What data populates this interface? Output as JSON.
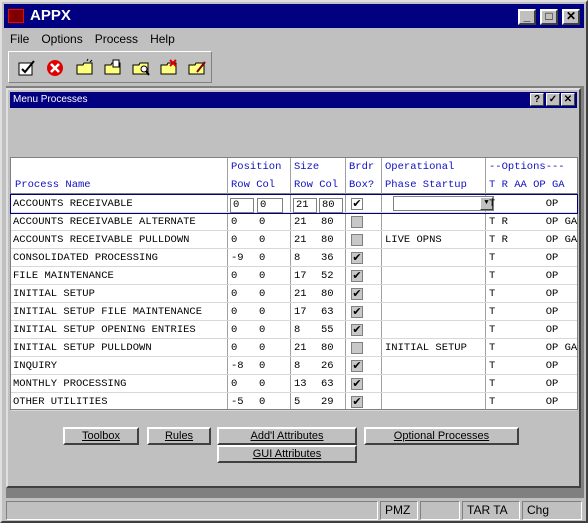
{
  "app": {
    "title": "APPX"
  },
  "menu": [
    "File",
    "Options",
    "Process",
    "Help"
  ],
  "toolbar": [
    "ok-check-icon",
    "cancel-icon",
    "folder-new-icon",
    "folder-open-icon",
    "folder-find-icon",
    "folder-delete-icon",
    "folder-edit-icon"
  ],
  "child": {
    "title": "Menu Processes",
    "buttons": [
      "?",
      "✓",
      "✕"
    ]
  },
  "grid": {
    "headers": {
      "process_name": "Process Name",
      "position": "Position",
      "pos_sub": "Row Col",
      "size": "Size",
      "size_sub": "Row Col",
      "brdr": "Brdr",
      "box": "Box?",
      "operational": "Operational",
      "phase": "Phase Startup",
      "options": "--Options---",
      "options_sub": "T R AA OP GA"
    },
    "rows": [
      {
        "name": "ACCOUNTS RECEIVABLE",
        "prow": "0",
        "pcol": "0",
        "srow": "21",
        "scol": "80",
        "box": true,
        "box_dim": false,
        "phase": "",
        "opts": "T        OP"
      },
      {
        "name": "ACCOUNTS RECEIVABLE ALTERNATE",
        "prow": "0",
        "pcol": "0",
        "srow": "21",
        "scol": "80",
        "box": false,
        "box_dim": true,
        "phase": "",
        "opts": "T R      OP GA"
      },
      {
        "name": "ACCOUNTS RECEIVABLE PULLDOWN",
        "prow": "0",
        "pcol": "0",
        "srow": "21",
        "scol": "80",
        "box": false,
        "box_dim": true,
        "phase": "LIVE OPNS",
        "opts": "T R      OP GA"
      },
      {
        "name": "CONSOLIDATED PROCESSING",
        "prow": "-9",
        "pcol": "0",
        "srow": "8",
        "scol": "36",
        "box": true,
        "box_dim": true,
        "phase": "",
        "opts": "T        OP"
      },
      {
        "name": "FILE MAINTENANCE",
        "prow": "0",
        "pcol": "0",
        "srow": "17",
        "scol": "52",
        "box": true,
        "box_dim": true,
        "phase": "",
        "opts": "T        OP"
      },
      {
        "name": "INITIAL SETUP",
        "prow": "0",
        "pcol": "0",
        "srow": "21",
        "scol": "80",
        "box": true,
        "box_dim": true,
        "phase": "",
        "opts": "T        OP"
      },
      {
        "name": "INITIAL SETUP FILE MAINTENANCE",
        "prow": "0",
        "pcol": "0",
        "srow": "17",
        "scol": "63",
        "box": true,
        "box_dim": true,
        "phase": "",
        "opts": "T        OP"
      },
      {
        "name": "INITIAL SETUP OPENING ENTRIES",
        "prow": "0",
        "pcol": "0",
        "srow": "8",
        "scol": "55",
        "box": true,
        "box_dim": true,
        "phase": "",
        "opts": "T        OP"
      },
      {
        "name": "INITIAL SETUP PULLDOWN",
        "prow": "0",
        "pcol": "0",
        "srow": "21",
        "scol": "80",
        "box": false,
        "box_dim": true,
        "phase": "INITIAL SETUP",
        "opts": "T        OP GA"
      },
      {
        "name": "INQUIRY",
        "prow": "-8",
        "pcol": "0",
        "srow": "8",
        "scol": "26",
        "box": true,
        "box_dim": true,
        "phase": "",
        "opts": "T        OP"
      },
      {
        "name": "MONTHLY PROCESSING",
        "prow": "0",
        "pcol": "0",
        "srow": "13",
        "scol": "63",
        "box": true,
        "box_dim": true,
        "phase": "",
        "opts": "T        OP"
      },
      {
        "name": "OTHER UTILITIES",
        "prow": "-5",
        "pcol": "0",
        "srow": "5",
        "scol": "29",
        "box": true,
        "box_dim": true,
        "phase": "",
        "opts": "T        OP"
      }
    ]
  },
  "buttons": {
    "toolbox": "Toolbox",
    "rules": "Rules",
    "addl": "Add'l Attributes",
    "optional": "Optional Processes",
    "gui": "GUI Attributes"
  },
  "status": {
    "s1": "PMZ",
    "s2": "TAR TA",
    "s3": "Chg"
  }
}
